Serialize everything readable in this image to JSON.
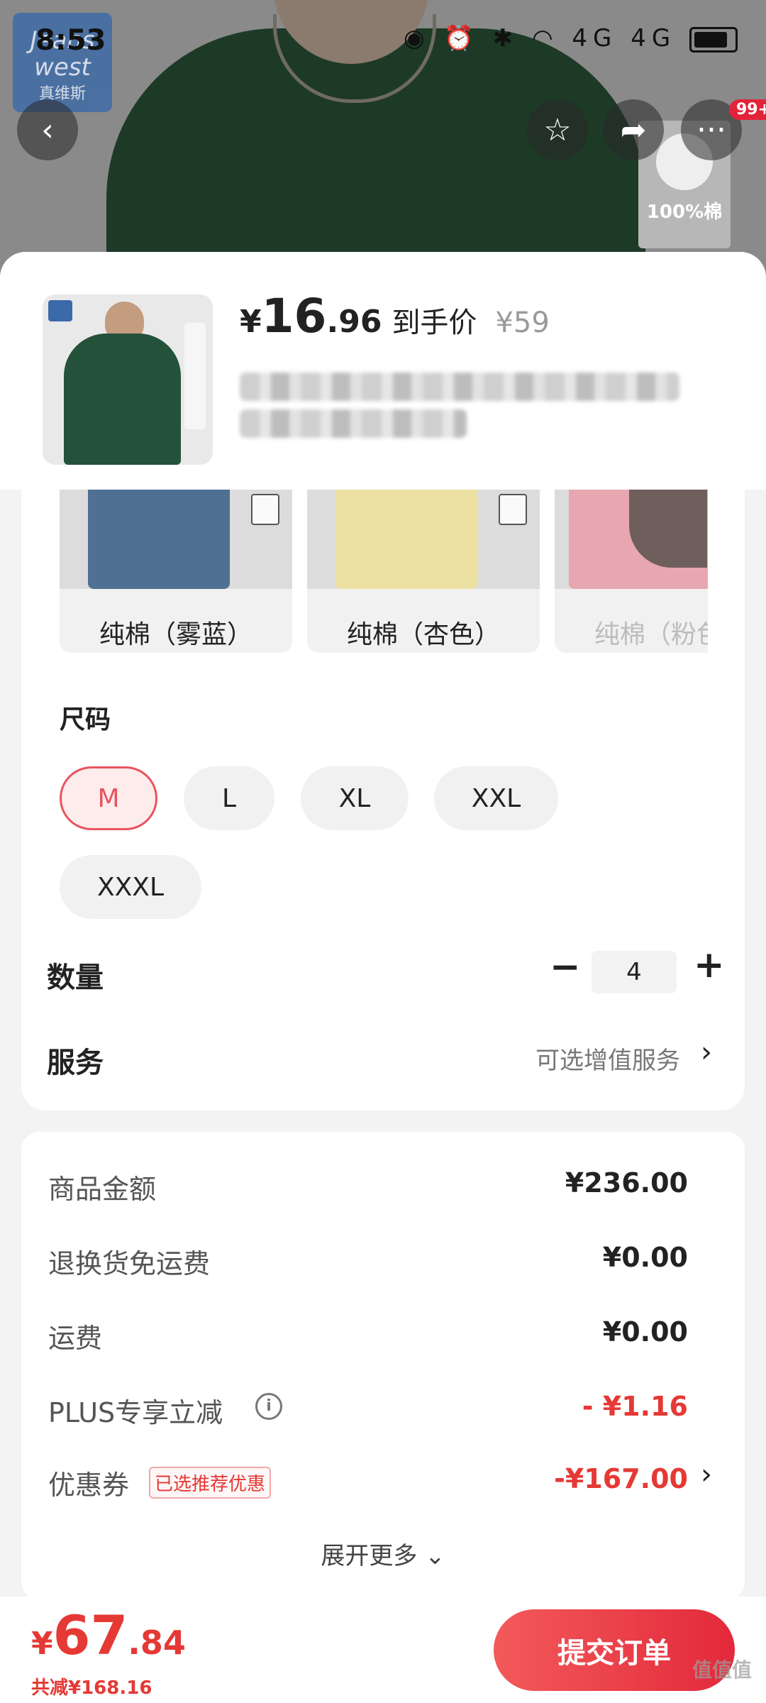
{
  "status_bar": {
    "time": "8:53",
    "network": "4G 4G"
  },
  "background": {
    "brand_logo_text": "Jeans west",
    "brand_logo_cn": "真维斯",
    "badge_text": "100%棉",
    "notification_count": "99+"
  },
  "product": {
    "price_symbol": "¥",
    "price_integer": "16",
    "price_decimal": ".96",
    "price_tag": "到手价",
    "original_price": "¥59"
  },
  "colors": [
    {
      "label": "纯棉（雾蓝）",
      "swatch": "#4f7092"
    },
    {
      "label": "纯棉（杏色）",
      "swatch": "#ece0a2"
    },
    {
      "label": "纯棉（粉色",
      "swatch": "#e7a7b0"
    }
  ],
  "size": {
    "title": "尺码",
    "options": [
      "M",
      "L",
      "XL",
      "XXL",
      "XXXL"
    ],
    "selected": "M"
  },
  "quantity": {
    "title": "数量",
    "value": "4",
    "minus": "−",
    "plus": "+"
  },
  "service": {
    "title": "服务",
    "value": "可选增值服务"
  },
  "summary": {
    "goods_amount_label": "商品金额",
    "goods_amount": "¥236.00",
    "return_shipping_label": "退换货免运费",
    "return_shipping": "¥0.00",
    "shipping_label": "运费",
    "shipping": "¥0.00",
    "plus_label": "PLUS专享立减",
    "plus_value": "- ¥1.16",
    "coupon_label": "优惠券",
    "coupon_tag": "已选推荐优惠",
    "coupon_value": "-¥167.00",
    "expand_more": "展开更多"
  },
  "footer": {
    "total_symbol": "¥",
    "total_integer": "67",
    "total_decimal": ".84",
    "saved": "共减¥168.16",
    "submit": "提交订单",
    "watermark": "值值值"
  },
  "colors_theme": {
    "accent": "#e53935",
    "selected_size_border": "#e8545f",
    "button_red": "#e3293b"
  }
}
